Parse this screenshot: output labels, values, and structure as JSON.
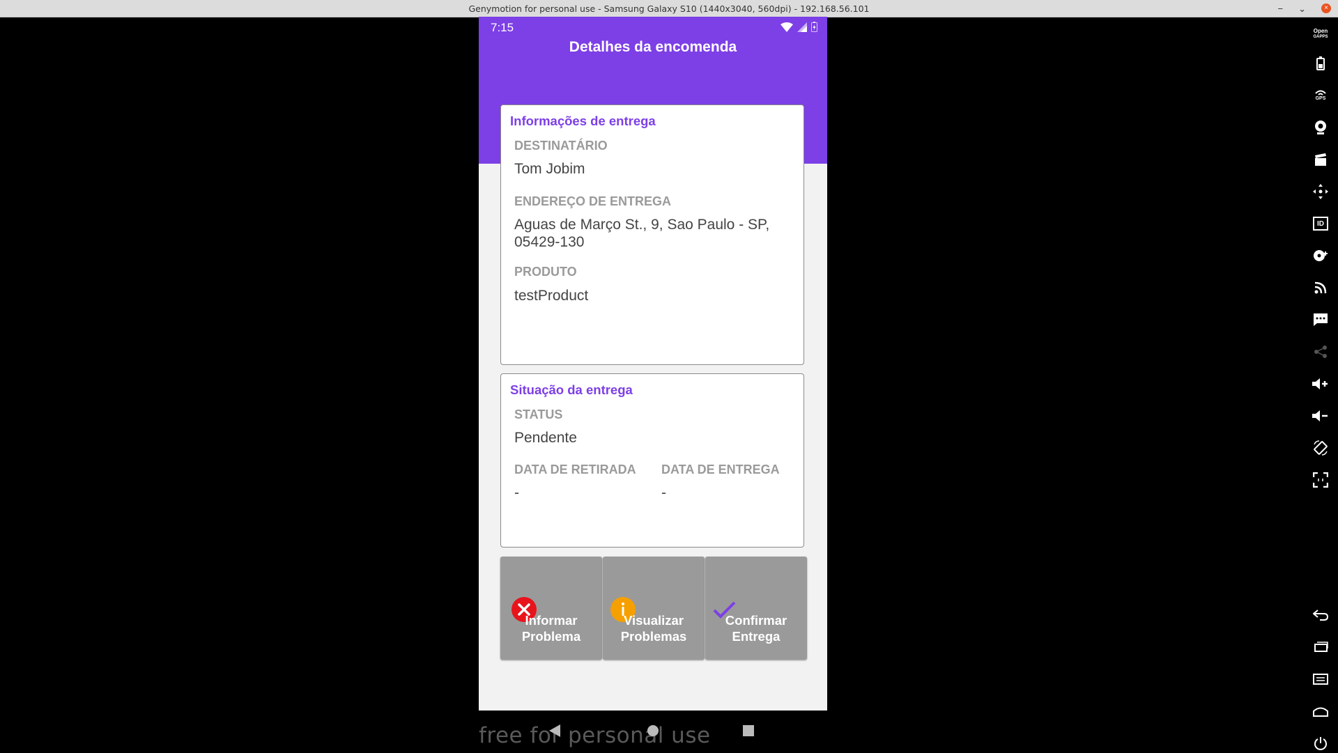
{
  "window": {
    "title": "Genymotion for personal use - Samsung Galaxy S10 (1440x3040, 560dpi) - 192.168.56.101",
    "minimize": "−",
    "restore": "⌄",
    "close": "×"
  },
  "statusbar": {
    "time": "7:15"
  },
  "app": {
    "title": "Detalhes da encomenda",
    "accent": "#7d3fe6"
  },
  "delivery_info": {
    "title": "Informações de entrega",
    "recipient_label": "DESTINATÁRIO",
    "recipient": "Tom Jobim",
    "address_label": "ENDEREÇO DE ENTREGA",
    "address": "Aguas de Março St., 9, Sao Paulo - SP, 05429-130",
    "product_label": "PRODUTO",
    "product": "testProduct"
  },
  "delivery_status": {
    "title": "Situação da entrega",
    "status_label": "STATUS",
    "status": "Pendente",
    "pickup_label": "DATA DE RETIRADA",
    "pickup": "-",
    "delivery_label": "DATA DE ENTREGA",
    "delivery": "-"
  },
  "actions": {
    "report": "Informar\nProblema",
    "view": "Visualizar\nProblemas",
    "confirm": "Confirmar\nEntrega"
  },
  "watermark": "free for personal use",
  "toolbar": {
    "opengapps_l1": "Open",
    "opengapps_l2": "GAPPS",
    "gps": "GPS",
    "id": "ID"
  }
}
